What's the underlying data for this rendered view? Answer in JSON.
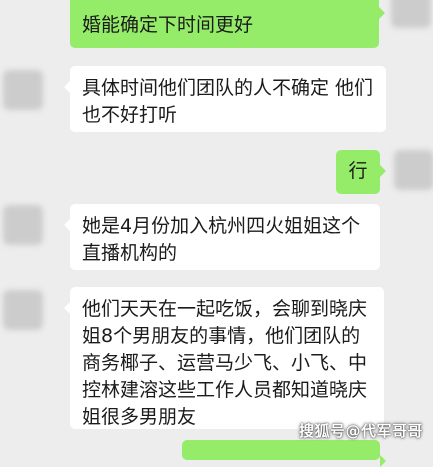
{
  "messages": [
    {
      "side": "out",
      "text": "婚能确定下时间更好"
    },
    {
      "side": "in",
      "text": "具体时间他们团队的人不确定 他们也不好打听"
    },
    {
      "side": "out",
      "text": "行"
    },
    {
      "side": "in",
      "text": "她是4月份加入杭州四火姐姐这个直播机构的"
    },
    {
      "side": "in",
      "text": "他们天天在一起吃饭，会聊到晓庆姐8个男朋友的事情，他们团队的商务椰子、运营马少飞、小飞、中控林建溶这些工作人员都知道晓庆姐很多男朋友"
    }
  ],
  "watermark": "搜狐号@代军哥哥",
  "colors": {
    "background": "#ededed",
    "incoming": "#ffffff",
    "outgoing": "#95ec69"
  }
}
